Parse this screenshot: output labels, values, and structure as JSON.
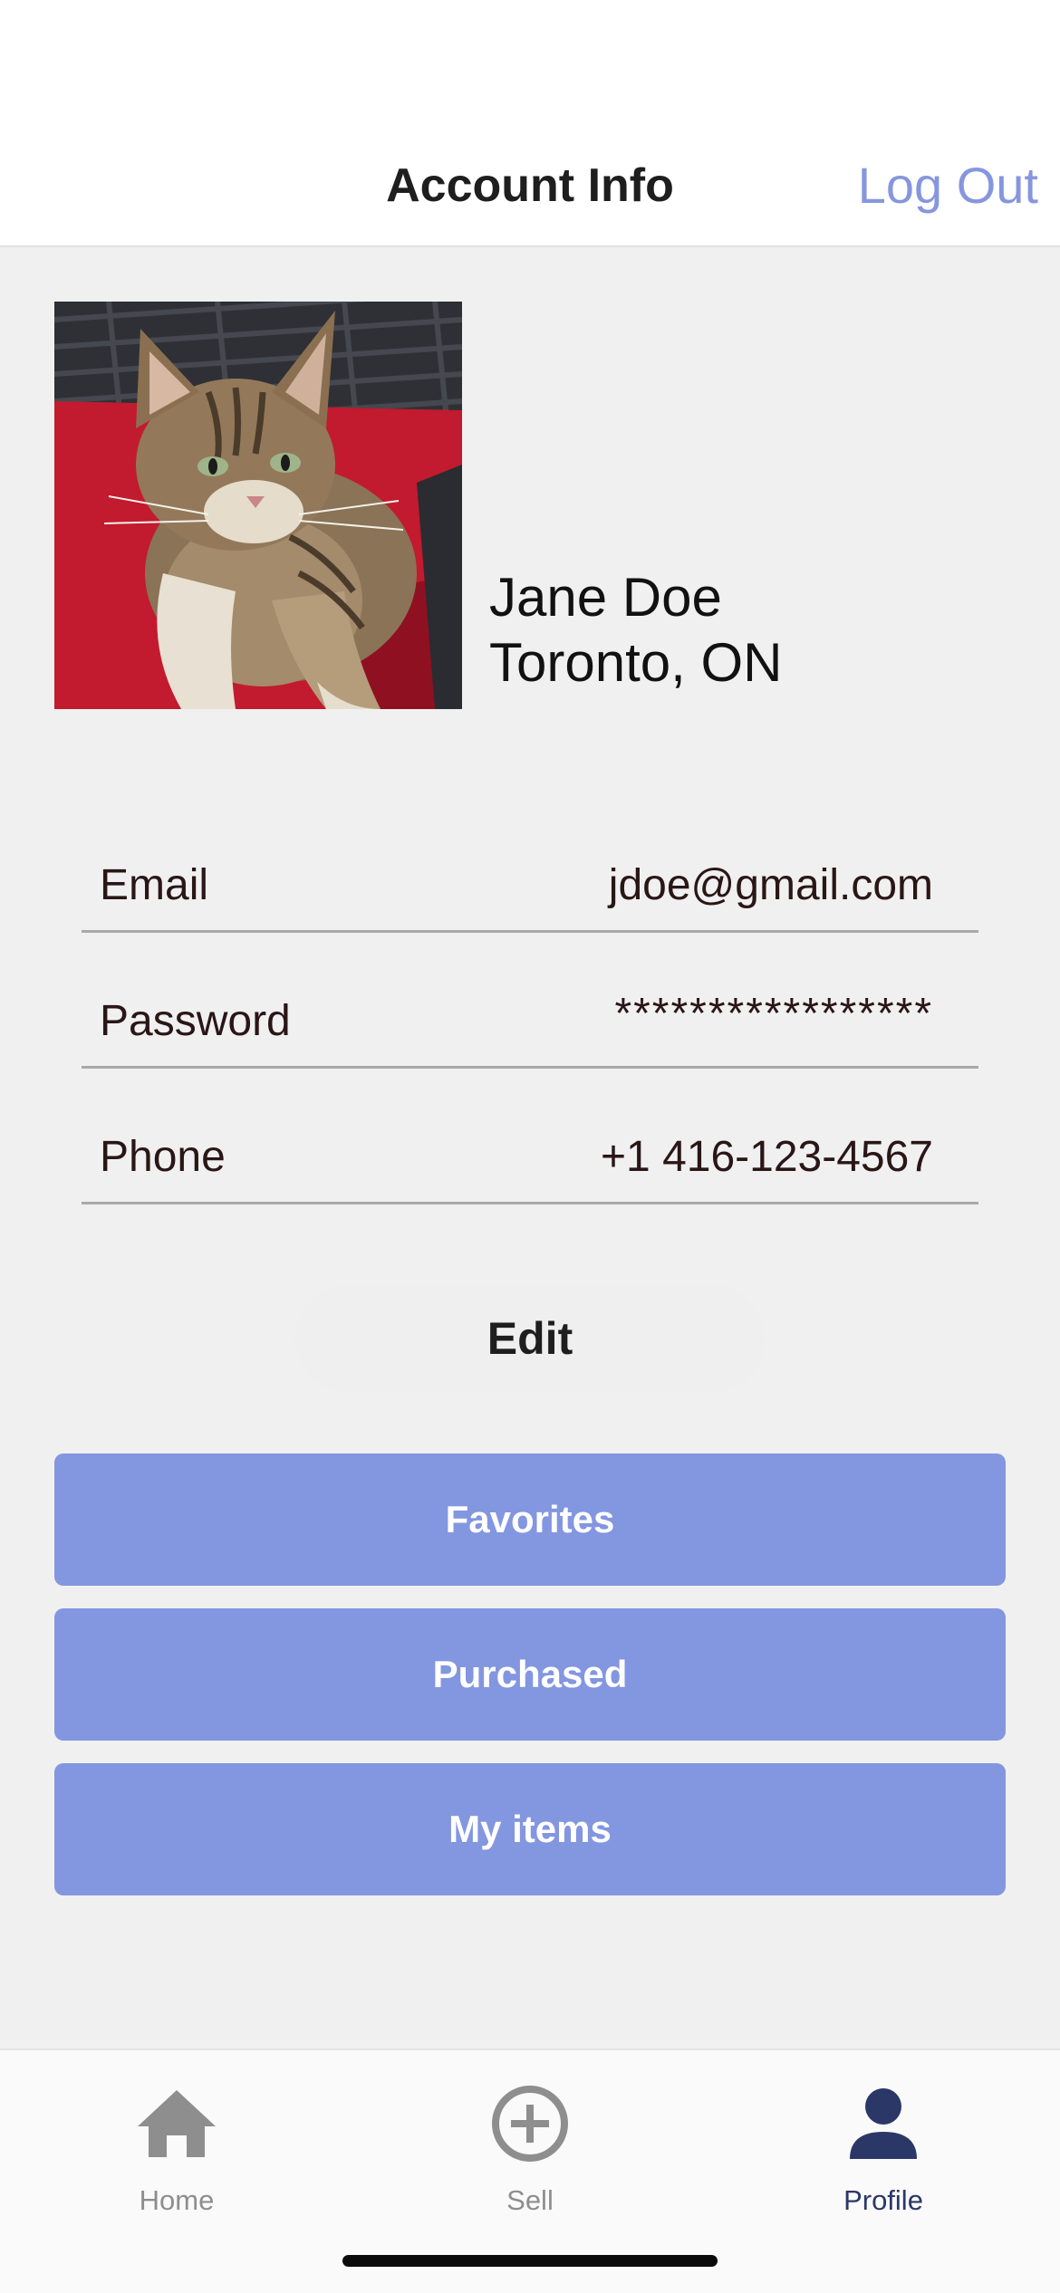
{
  "header": {
    "title": "Account Info",
    "logout_label": "Log Out"
  },
  "profile": {
    "avatar_alt": "cat-photo",
    "name": "Jane Doe",
    "location": "Toronto, ON"
  },
  "info": {
    "email_label": "Email",
    "email_value": "jdoe@gmail.com",
    "password_label": "Password",
    "password_value": "*****************",
    "phone_label": "Phone",
    "phone_value": "+1 416-123-4567"
  },
  "edit_label": "Edit",
  "actions": {
    "favorites": "Favorites",
    "purchased": "Purchased",
    "my_items": "My items"
  },
  "tabs": [
    {
      "label": "Home",
      "icon": "home-icon",
      "active": false
    },
    {
      "label": "Sell",
      "icon": "plus-circle-icon",
      "active": false
    },
    {
      "label": "Profile",
      "icon": "person-icon",
      "active": true
    }
  ],
  "colors": {
    "accent": "#8396e0",
    "link": "#8696de",
    "active_tab": "#2b3767",
    "inactive_tab": "#8e8e8e"
  }
}
